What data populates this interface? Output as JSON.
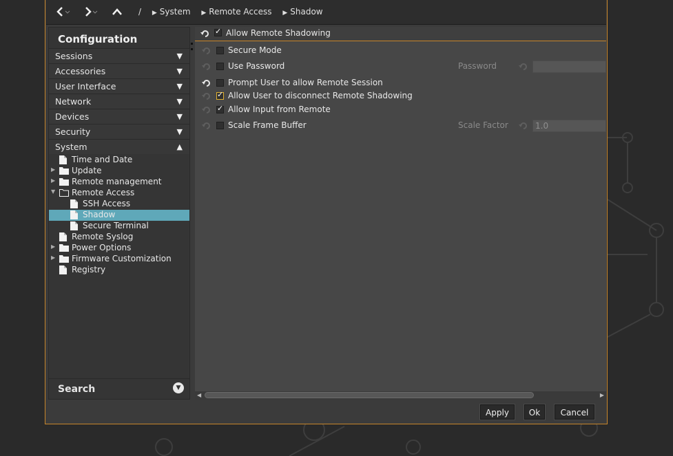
{
  "nav": {
    "back_icon": "chevron-left-icon",
    "forward_icon": "chevron-right-icon",
    "up_icon": "chevron-up-icon",
    "root": "/",
    "crumbs": [
      "System",
      "Remote Access",
      "Shadow"
    ]
  },
  "sidebar": {
    "title": "Configuration",
    "categories": [
      {
        "label": "Sessions",
        "expanded": false
      },
      {
        "label": "Accessories",
        "expanded": false
      },
      {
        "label": "User Interface",
        "expanded": false
      },
      {
        "label": "Network",
        "expanded": false
      },
      {
        "label": "Devices",
        "expanded": false
      },
      {
        "label": "Security",
        "expanded": false
      },
      {
        "label": "System",
        "expanded": true
      }
    ],
    "tree": [
      {
        "label": "Time and Date",
        "type": "file",
        "level": 0,
        "expander": ""
      },
      {
        "label": "Update",
        "type": "folder",
        "level": 0,
        "expander": "collapsed"
      },
      {
        "label": "Remote management",
        "type": "folder",
        "level": 0,
        "expander": "collapsed"
      },
      {
        "label": "Remote Access",
        "type": "folder-open",
        "level": 0,
        "expander": "expanded"
      },
      {
        "label": "SSH Access",
        "type": "file",
        "level": 1,
        "expander": ""
      },
      {
        "label": "Shadow",
        "type": "file",
        "level": 1,
        "expander": "",
        "selected": true
      },
      {
        "label": "Secure Terminal",
        "type": "file",
        "level": 1,
        "expander": ""
      },
      {
        "label": "Remote Syslog",
        "type": "file",
        "level": 0,
        "expander": ""
      },
      {
        "label": "Power Options",
        "type": "folder",
        "level": 0,
        "expander": "collapsed"
      },
      {
        "label": "Firmware Customization",
        "type": "folder",
        "level": 0,
        "expander": "collapsed"
      },
      {
        "label": "Registry",
        "type": "file",
        "level": 0,
        "expander": ""
      }
    ],
    "search_label": "Search",
    "search_icon": "chevron-down-circle-icon"
  },
  "options": {
    "header": {
      "label": "Allow Remote Shadowing",
      "checked": true
    },
    "items": [
      {
        "label": "Secure Mode",
        "checked": false
      },
      {
        "label": "Use Password",
        "checked": false,
        "field_label": "Password",
        "field_value": ""
      },
      {
        "label": "Prompt User to allow Remote Session",
        "checked": false
      },
      {
        "label": "Allow User to disconnect Remote Shadowing",
        "checked": true
      },
      {
        "label": "Allow Input from Remote",
        "checked": true
      },
      {
        "label": "Scale Frame Buffer",
        "checked": false,
        "field_label": "Scale Factor",
        "field_value": "1.0"
      }
    ]
  },
  "footer": {
    "apply": "Apply",
    "ok": "Ok",
    "cancel": "Cancel"
  },
  "colors": {
    "accent": "#c8862a",
    "selection": "#5fa8b9"
  }
}
